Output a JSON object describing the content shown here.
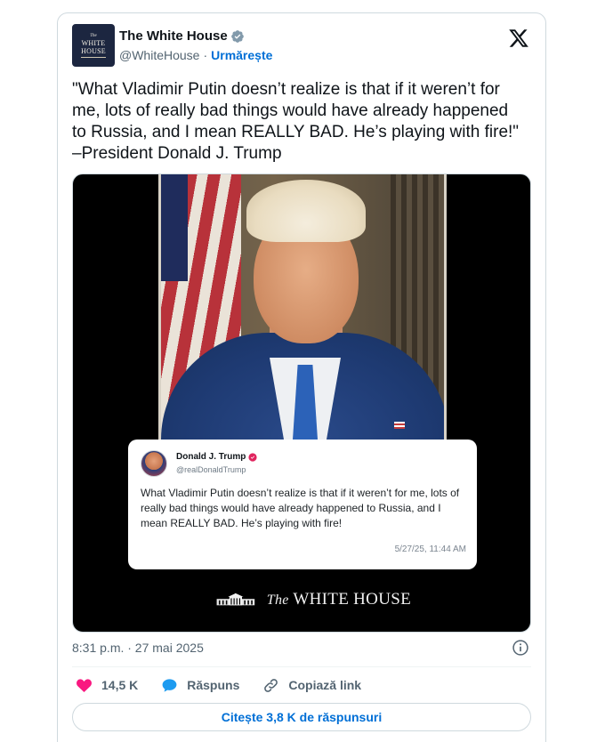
{
  "author": {
    "avatar_text": [
      "The",
      "WHITE",
      "HOUSE"
    ],
    "name": "The White House",
    "handle": "@WhiteHouse",
    "separator": "·",
    "follow_label": "Urmărește"
  },
  "tweet": {
    "text": "\"What Vladimir Putin doesn’t realize is that if it weren’t for\nme, lots of really bad things would have already happened\nto Russia, and I mean REALLY BAD. He’s playing with fire!\"\n–President Donald J. Trump",
    "timestamp": "8:31 p.m. · 27 mai 2025"
  },
  "media": {
    "quoted_post": {
      "name": "Donald J. Trump",
      "handle": "@realDonaldTrump",
      "text": "What Vladimir Putin doesn’t realize is that if it weren’t for me, lots of really bad things would have already happened to Russia, and I mean REALLY BAD. He’s playing with fire!",
      "time": "5/27/25, 11:44 AM"
    },
    "footer_prefix": "The",
    "footer_brand": "WHITE HOUSE"
  },
  "actions": {
    "likes": "14,5 K",
    "reply_label": "Răspuns",
    "copy_link_label": "Copiază link"
  },
  "replies_button_label": "Citește 3,8 K de răspunsuri",
  "colors": {
    "link_blue": "#006fd6",
    "like_pink": "#f91880",
    "reply_blue": "#1d9bf0",
    "verified_gray": "#829aab"
  }
}
